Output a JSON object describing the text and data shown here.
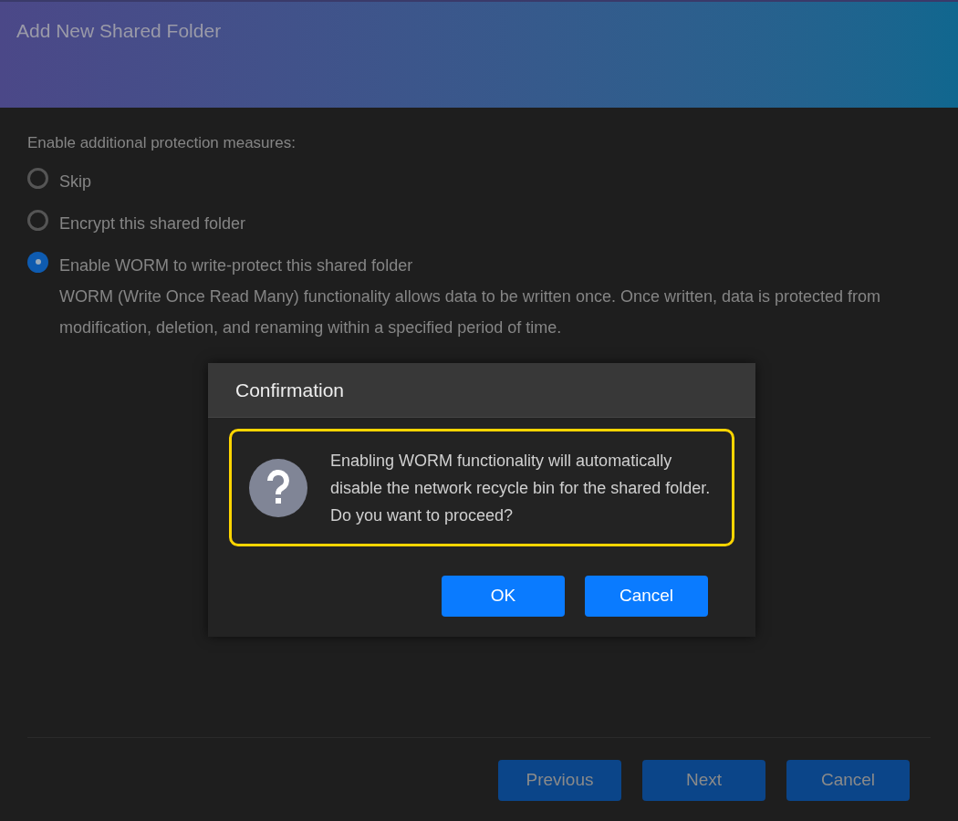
{
  "window": {
    "title": "Add New Shared Folder"
  },
  "protection": {
    "label": "Enable additional protection measures:",
    "options": [
      {
        "label": "Skip",
        "selected": false
      },
      {
        "label": "Encrypt this shared folder",
        "selected": false
      },
      {
        "label": "Enable WORM to write-protect this shared folder",
        "selected": true,
        "description": "WORM (Write Once Read Many) functionality allows data to be written once. Once written, data is protected from modification, deletion, and renaming within a specified period of time."
      }
    ]
  },
  "footer_buttons": [
    "Previous",
    "Next",
    "Cancel"
  ],
  "dialog": {
    "title": "Confirmation",
    "message": "Enabling WORM functionality will automatically disable the network recycle bin for the shared folder. Do you want to proceed?",
    "buttons": [
      "OK",
      "Cancel"
    ]
  }
}
